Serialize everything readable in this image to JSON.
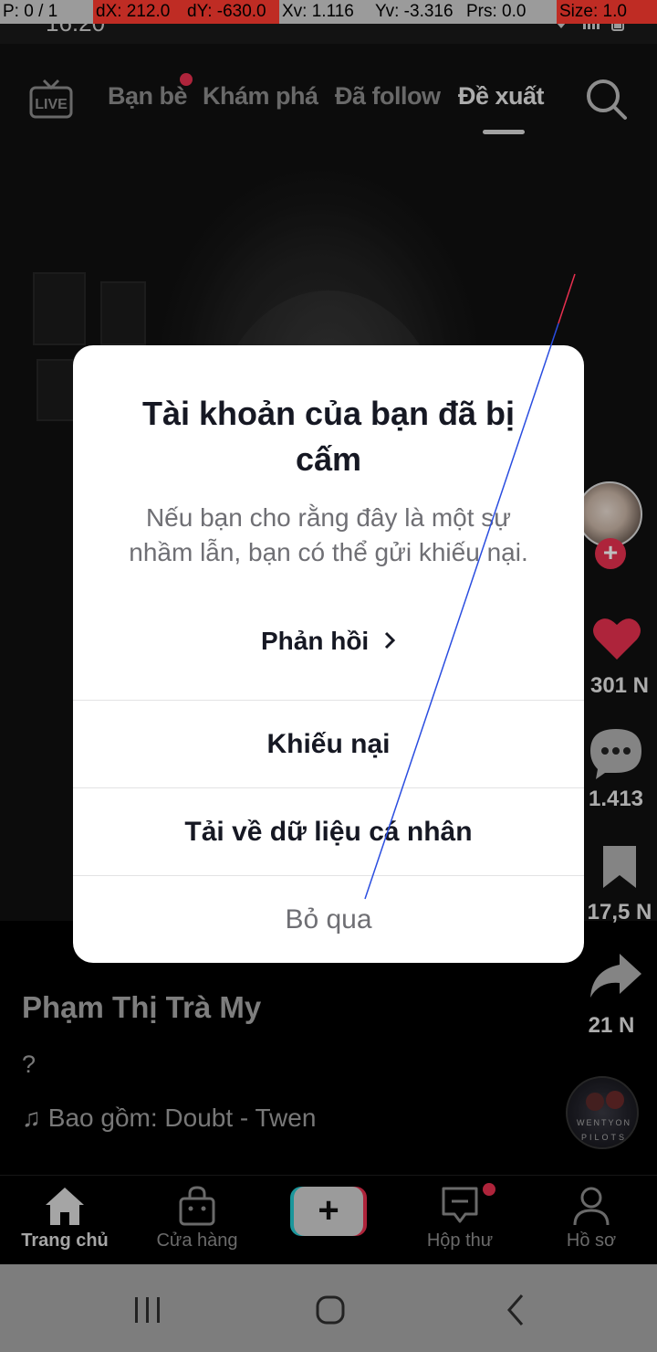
{
  "debug_overlay": {
    "pointer": "P: 0 / 1",
    "dx": "dX: 212.0",
    "dy": "dY: -630.0",
    "xv": "Xv: 1.116",
    "yv": "Yv: -3.316",
    "prs": "Prs: 0.0",
    "size": "Size: 1.0"
  },
  "status_bar": {
    "time": "16:20"
  },
  "top_nav": {
    "live_label": "LIVE",
    "tabs": [
      {
        "label": "Bạn bè",
        "has_dot": true
      },
      {
        "label": "Khám phá"
      },
      {
        "label": "Đã follow"
      },
      {
        "label": "Đề xuất",
        "active": true
      }
    ],
    "search_icon": "search-icon"
  },
  "video": {
    "author": "Phạm Thị Trà My",
    "description": "?",
    "music": "♫ Bao gồm: Doubt - Twen",
    "music_disc_text_1": "WENTYON",
    "music_disc_text_2": "PILOTS"
  },
  "right_rail": {
    "likes": "301 N",
    "comments": "1.413",
    "saves": "17,5 N",
    "shares": "21 N"
  },
  "modal": {
    "title": "Tài khoản của bạn đã bị cấm",
    "body": "Nếu bạn cho rằng đây là một sự nhầm lẫn, bạn có thể gửi khiếu nại.",
    "feedback_link": "Phản hồi",
    "appeal_button": "Khiếu nại",
    "download_button": "Tải về dữ liệu cá nhân",
    "skip_button": "Bỏ qua"
  },
  "bottom_nav": {
    "items": [
      {
        "label": "Trang chủ",
        "active": true,
        "icon": "home-icon"
      },
      {
        "label": "Cửa hàng",
        "icon": "shop-icon"
      },
      {
        "label": "+",
        "icon": "create-icon"
      },
      {
        "label": "Hộp thư",
        "icon": "inbox-icon",
        "has_dot": true
      },
      {
        "label": "Hồ sơ",
        "icon": "profile-icon"
      }
    ]
  },
  "colors": {
    "accent_red": "#e8304f",
    "accent_cyan": "#25c9cf",
    "debug_red": "#ff3b30",
    "debug_gray": "#cfcfcf"
  }
}
